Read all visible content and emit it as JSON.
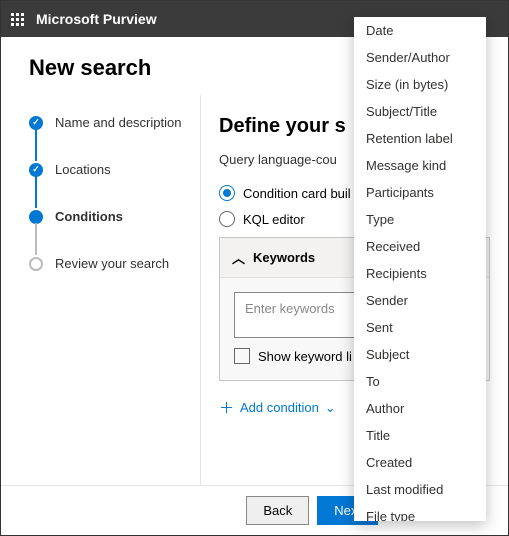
{
  "header": {
    "brand": "Microsoft Purview"
  },
  "page": {
    "title": "New search"
  },
  "steps": {
    "s1": "Name and description",
    "s2": "Locations",
    "s3": "Conditions",
    "s4": "Review your search"
  },
  "main": {
    "heading": "Define your s",
    "subtitle": "Query language-cou",
    "radio_builder": "Condition card buil",
    "radio_kql": "KQL editor",
    "keywords_header": "Keywords",
    "keywords_placeholder": "Enter keywords",
    "show_keyword_list": "Show keyword li",
    "add_condition": "Add condition"
  },
  "footer": {
    "back": "Back",
    "next": "Next"
  },
  "dropdown": {
    "i0": "Date",
    "i1": "Sender/Author",
    "i2": "Size (in bytes)",
    "i3": "Subject/Title",
    "i4": "Retention label",
    "i5": "Message kind",
    "i6": "Participants",
    "i7": "Type",
    "i8": "Received",
    "i9": "Recipients",
    "i10": "Sender",
    "i11": "Sent",
    "i12": "Subject",
    "i13": "To",
    "i14": "Author",
    "i15": "Title",
    "i16": "Created",
    "i17": "Last modified",
    "i18": "File type"
  }
}
